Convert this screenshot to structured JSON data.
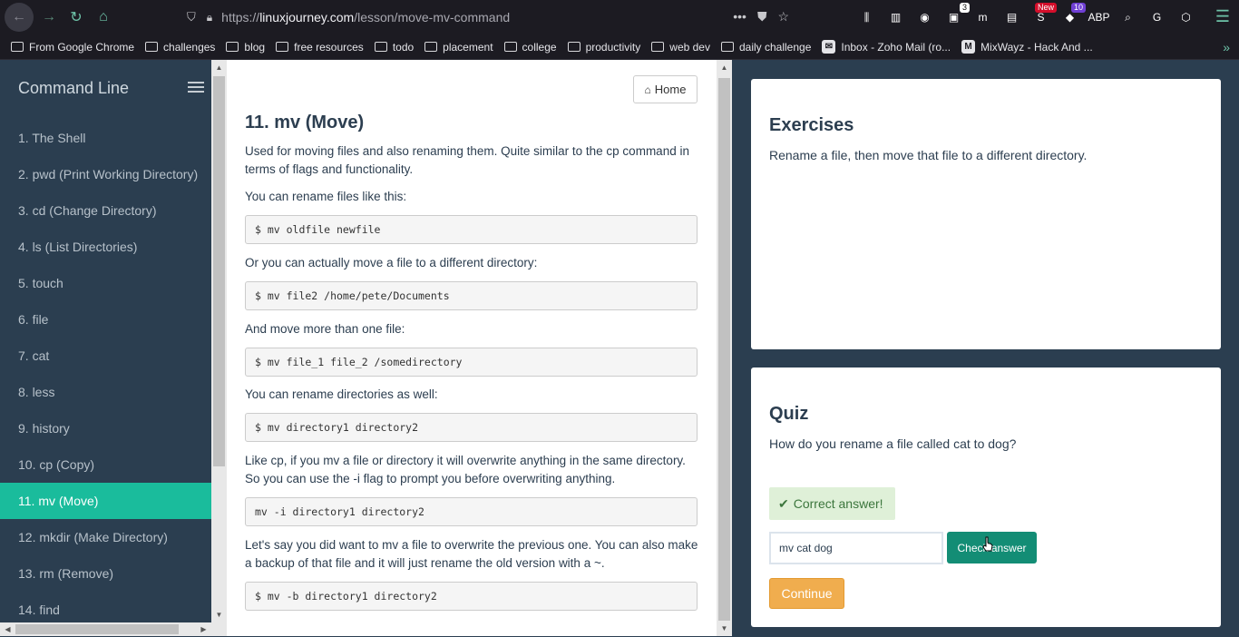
{
  "browser": {
    "url_prefix": "https://",
    "url_domain": "linuxjourney.com",
    "url_path": "/lesson/move-mv-command",
    "extensions": [
      {
        "icon": "library-icon",
        "glyph": "⫼",
        "badge": ""
      },
      {
        "icon": "sidebar-icon",
        "glyph": "▥",
        "badge": ""
      },
      {
        "icon": "account-icon",
        "glyph": "◉",
        "badge": ""
      },
      {
        "icon": "extension-3-icon",
        "glyph": "▣",
        "badge": "3"
      },
      {
        "icon": "m-extension-icon",
        "glyph": "m",
        "badge": ""
      },
      {
        "icon": "reader-icon",
        "glyph": "▤",
        "badge": ""
      },
      {
        "icon": "news-extension-icon",
        "glyph": "S",
        "badge": "New"
      },
      {
        "icon": "extension-10-icon",
        "glyph": "◆",
        "badge": "10"
      },
      {
        "icon": "adblock-icon",
        "glyph": "ABP",
        "badge": ""
      },
      {
        "icon": "search-extension-icon",
        "glyph": "⌕",
        "badge": ""
      },
      {
        "icon": "grammarly-icon",
        "glyph": "G",
        "badge": ""
      },
      {
        "icon": "cube-extension-icon",
        "glyph": "⬡",
        "badge": ""
      }
    ],
    "bookmarks": [
      {
        "label": "From Google Chrome",
        "type": "folder"
      },
      {
        "label": "challenges",
        "type": "folder"
      },
      {
        "label": "blog",
        "type": "folder"
      },
      {
        "label": "free resources",
        "type": "folder"
      },
      {
        "label": "todo",
        "type": "folder"
      },
      {
        "label": "placement",
        "type": "folder"
      },
      {
        "label": "college",
        "type": "folder"
      },
      {
        "label": "productivity",
        "type": "folder"
      },
      {
        "label": "web dev",
        "type": "folder"
      },
      {
        "label": "daily challenge",
        "type": "folder"
      },
      {
        "label": "Inbox - Zoho Mail (ro...",
        "type": "link"
      },
      {
        "label": "MixWayz - Hack And ...",
        "type": "link"
      }
    ]
  },
  "sidebar": {
    "title": "Command Line",
    "items": [
      {
        "label": "1. The Shell"
      },
      {
        "label": "2. pwd (Print Working Directory)"
      },
      {
        "label": "3. cd (Change Directory)"
      },
      {
        "label": "4. ls (List Directories)"
      },
      {
        "label": "5. touch"
      },
      {
        "label": "6. file"
      },
      {
        "label": "7. cat"
      },
      {
        "label": "8. less"
      },
      {
        "label": "9. history"
      },
      {
        "label": "10. cp (Copy)"
      },
      {
        "label": "11. mv (Move)",
        "active": true
      },
      {
        "label": "12. mkdir (Make Directory)"
      },
      {
        "label": "13. rm (Remove)"
      },
      {
        "label": "14. find"
      }
    ]
  },
  "lesson": {
    "home_label": "Home",
    "title": "11. mv (Move)",
    "p1": "Used for moving files and also renaming them. Quite similar to the cp command in terms of flags and functionality.",
    "p2": "You can rename files like this:",
    "code1": "$ mv oldfile newfile",
    "p3": "Or you can actually move a file to a different directory:",
    "code2": "$ mv file2 /home/pete/Documents",
    "p4": "And move more than one file:",
    "code3": "$ mv file_1 file_2 /somedirectory",
    "p5": "You can rename directories as well:",
    "code4": "$ mv directory1 directory2",
    "p6": "Like cp, if you mv a file or directory it will overwrite anything in the same directory. So you can use the -i flag to prompt you before overwriting anything.",
    "code5": "mv -i directory1 directory2",
    "p7": "Let's say you did want to mv a file to overwrite the previous one. You can also make a backup of that file and it will just rename the old version with a ~.",
    "code6": "$ mv -b directory1 directory2"
  },
  "exercises": {
    "heading": "Exercises",
    "text": "Rename a file, then move that file to a different directory."
  },
  "quiz": {
    "heading": "Quiz",
    "question": "How do you rename a file called cat to dog?",
    "feedback": "Correct answer!",
    "answer_value": "mv cat dog",
    "check_label": "Check answer",
    "continue_label": "Continue"
  },
  "colors": {
    "accent": "#1abc9c",
    "sidebar_bg": "#2b3e50",
    "check_btn": "#138d75",
    "continue_btn": "#f0ad4e",
    "success_bg": "#dff0d8"
  }
}
